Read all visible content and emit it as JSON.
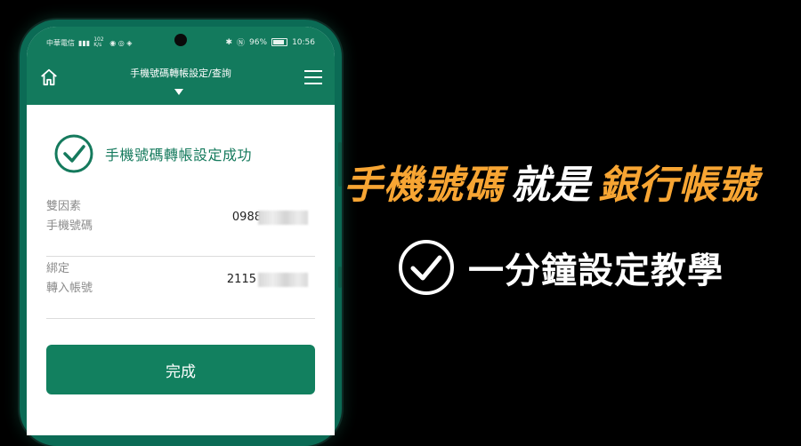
{
  "status_bar": {
    "carrier": "中華電信",
    "net_speed": "102 K/s",
    "battery": "96%",
    "time": "10:56"
  },
  "header": {
    "title": "手機號碼轉帳設定/查詢"
  },
  "result": {
    "message": "手機號碼轉帳設定成功"
  },
  "fields": [
    {
      "label_line1": "雙因素",
      "label_line2": "手機號碼",
      "value": "0988"
    },
    {
      "label_line1": "綁定",
      "label_line2": "轉入帳號",
      "value": "2115"
    }
  ],
  "actions": {
    "done_label": "完成"
  },
  "banner": {
    "part1": "手機號碼",
    "part2": "就是",
    "part3": "銀行帳號",
    "subtitle": "一分鐘設定教學"
  },
  "colors": {
    "brand_green": "#137a5d",
    "accent_orange": "#f7a533"
  }
}
